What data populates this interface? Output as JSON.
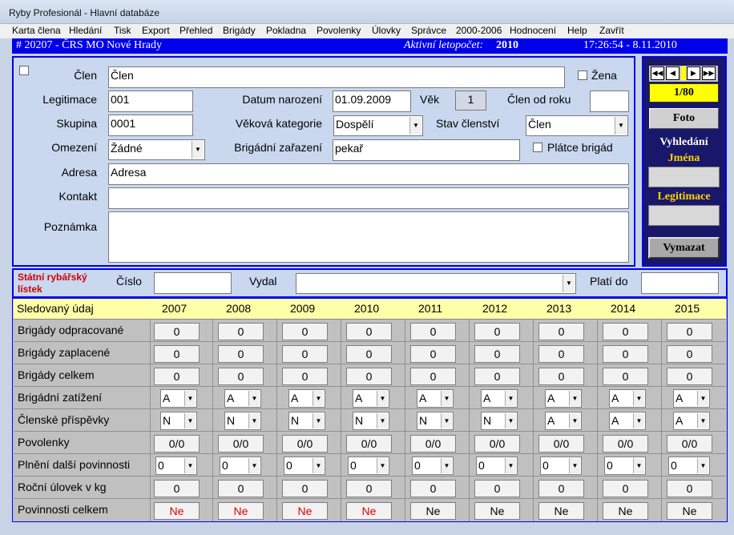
{
  "window": {
    "title": "Ryby Profesionál - Hlavní databáze"
  },
  "menu": [
    "Karta člena",
    "Hledání",
    "Tisk",
    "Export",
    "Přehled",
    "Brigády",
    "Pokladna",
    "Povolenky",
    "Úlovky",
    "Správce",
    "2000-2006",
    "Hodnocení",
    "Help",
    "Zavřít"
  ],
  "status": {
    "org": "# 20207 - ČRS MO Nové Hrady",
    "year_label": "Aktivní letopočet:",
    "year": "2010",
    "datetime": "17:26:54 - 8.11.2010"
  },
  "member": {
    "clen_label": "Člen",
    "clen": "Člen",
    "zena_label": "Žena",
    "legitimace_label": "Legitimace",
    "legitimace": "001",
    "datum_label": "Datum narození",
    "datum": "01.09.2009",
    "vek_label": "Věk",
    "vek": "1",
    "clen_od_label": "Člen od roku",
    "clen_od": "",
    "skupina_label": "Skupina",
    "skupina": "0001",
    "vekova_label": "Věková kategorie",
    "vekova": "Dospělí",
    "stav_label": "Stav členství",
    "stav": "Člen",
    "omezeni_label": "Omezení",
    "omezeni": "Žádné",
    "brig_zar_label": "Brigádní zařazení",
    "brig_zar": "pekař",
    "platce_label": "Plátce brigád",
    "adresa_label": "Adresa",
    "adresa": "Adresa",
    "kontakt_label": "Kontakt",
    "kontakt": "",
    "poznamka_label": "Poznámka",
    "poznamka": ""
  },
  "nav": {
    "record": "1/80",
    "foto": "Foto",
    "search_title_1": "Vyhledání",
    "search_title_2": "Jména",
    "legit_label": "Legitimace",
    "clear": "Vymazat",
    "name_query": "",
    "legit_query": ""
  },
  "license": {
    "title": "Státní rybářský lístek",
    "cislo_label": "Číslo",
    "cislo": "",
    "vydal_label": "Vydal",
    "vydal": "",
    "plati_label": "Platí do",
    "plati": ""
  },
  "grid": {
    "header_label": "Sledovaný údaj",
    "years": [
      "2007",
      "2008",
      "2009",
      "2010",
      "2011",
      "2012",
      "2013",
      "2014",
      "2015"
    ],
    "rows": [
      {
        "label": "Brigády odpracované",
        "type": "cell",
        "values": [
          "0",
          "0",
          "0",
          "0",
          "0",
          "0",
          "0",
          "0",
          "0"
        ]
      },
      {
        "label": "Brigády zaplacené",
        "type": "cell",
        "values": [
          "0",
          "0",
          "0",
          "0",
          "0",
          "0",
          "0",
          "0",
          "0"
        ]
      },
      {
        "label": "Brigády celkem",
        "type": "cell",
        "values": [
          "0",
          "0",
          "0",
          "0",
          "0",
          "0",
          "0",
          "0",
          "0"
        ]
      },
      {
        "label": "Brigádní zatížení",
        "type": "select",
        "values": [
          "A",
          "A",
          "A",
          "A",
          "A",
          "A",
          "A",
          "A",
          "A"
        ]
      },
      {
        "label": "Členské příspěvky",
        "type": "select",
        "values": [
          "N",
          "N",
          "N",
          "N",
          "N",
          "N",
          "A",
          "A",
          "A"
        ]
      },
      {
        "label": "Povolenky",
        "type": "cell",
        "values": [
          "0/0",
          "0/0",
          "0/0",
          "0/0",
          "0/0",
          "0/0",
          "0/0",
          "0/0",
          "0/0"
        ]
      },
      {
        "label": "Plnění další povinnosti",
        "type": "wideselect",
        "values": [
          "0",
          "0",
          "0",
          "0",
          "0",
          "0",
          "0",
          "0",
          "0"
        ]
      },
      {
        "label": "Roční úlovek v kg",
        "type": "cell",
        "values": [
          "0",
          "0",
          "0",
          "0",
          "0",
          "0",
          "0",
          "0",
          "0"
        ]
      },
      {
        "label": "Povinnosti celkem",
        "type": "cell",
        "values": [
          "Ne",
          "Ne",
          "Ne",
          "Ne",
          "Ne",
          "Ne",
          "Ne",
          "Ne",
          "Ne"
        ],
        "red_count": 4
      }
    ]
  },
  "colors": {
    "status_bg": "#0000e8",
    "nav_bg": "#18176a",
    "record_bg": "#ffff00",
    "year_bg": "#ffffa8",
    "alert": "#e00000"
  }
}
